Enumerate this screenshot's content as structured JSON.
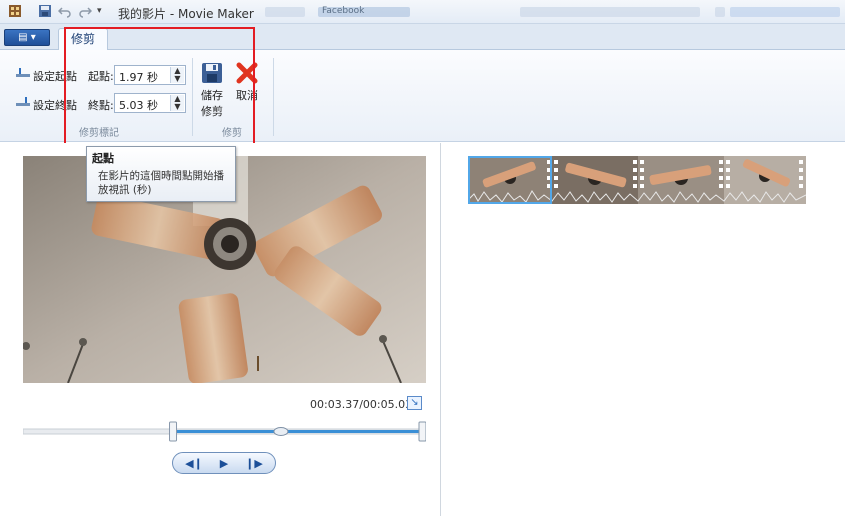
{
  "titlebar": {
    "title": "我的影片 - Movie Maker",
    "background_tab": "Facebook"
  },
  "ribbon": {
    "app_menu_glyph": "▤ ▾",
    "tab_label": "修剪",
    "set_start_label": "設定起點",
    "set_end_label": "設定終點",
    "start_label": "起點:",
    "start_value": "1.97 秒",
    "end_label": "終點:",
    "end_value": "5.03 秒",
    "save_label_1": "儲存",
    "save_label_2": "修剪",
    "cancel_label": "取消",
    "group_trim_markers": "修剪標記",
    "group_trim": "修剪"
  },
  "tooltip": {
    "title": "起點",
    "body": "在影片的這個時間點開始播放視訊 (秒)"
  },
  "player": {
    "timecode": "00:03.37/00:05.03",
    "progress_fraction": 0.64,
    "trim_start_fraction": 0.37,
    "trim_end_fraction": 1.0
  },
  "colors": {
    "highlight_box": "#e31c23",
    "accent": "#3a8fd6",
    "ribbon_bg": "#eaf0f8"
  },
  "icons": {
    "save": "floppy-disk-icon",
    "cancel": "red-x-icon",
    "set_start": "set-start-icon",
    "set_end": "set-end-icon",
    "expand": "expand-arrow-icon"
  }
}
